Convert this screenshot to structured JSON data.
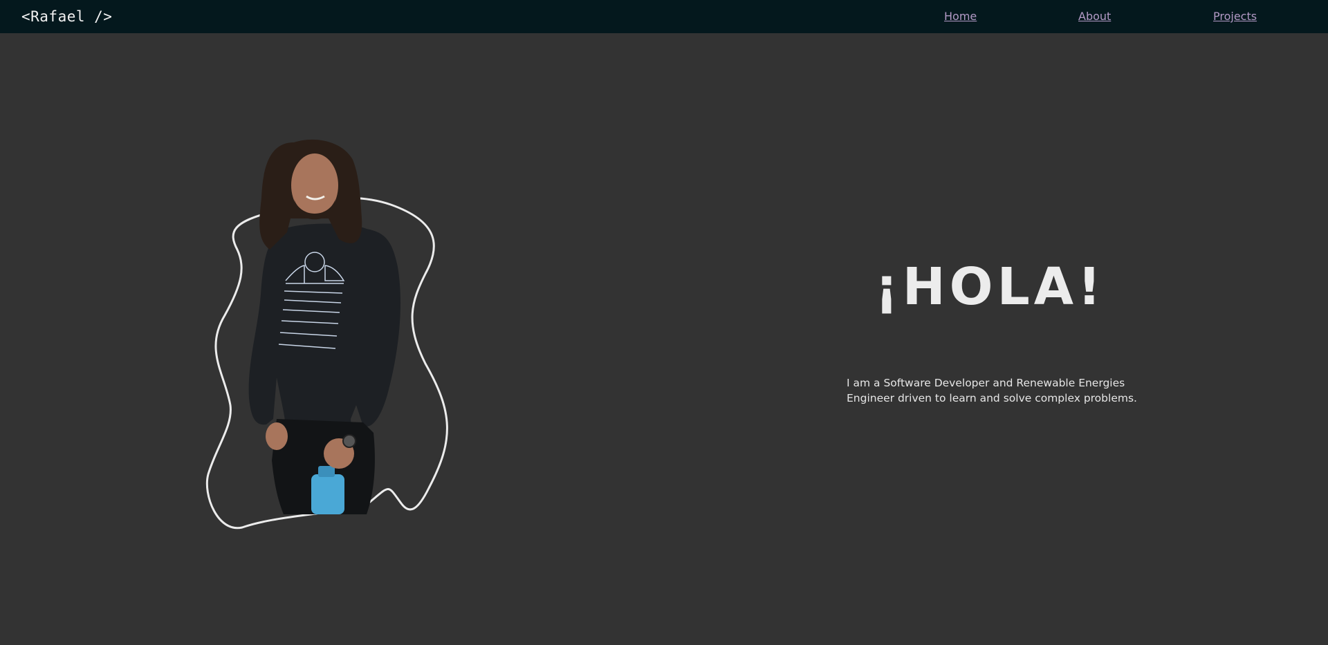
{
  "brand": {
    "logo_text": "<Rafael />"
  },
  "nav": {
    "items": [
      {
        "label": "Home"
      },
      {
        "label": "About"
      },
      {
        "label": "Projects"
      }
    ]
  },
  "hero": {
    "greeting": "¡HOLA!",
    "bio": "I am a Software Developer and Renewable Energies Engineer driven to learn and solve complex problems.",
    "portrait": {
      "description_icon": "person-photo"
    }
  },
  "colors": {
    "background": "#333333",
    "navbar": "#04181d",
    "nav_link": "#b39ac6",
    "outline": "#ececec"
  }
}
